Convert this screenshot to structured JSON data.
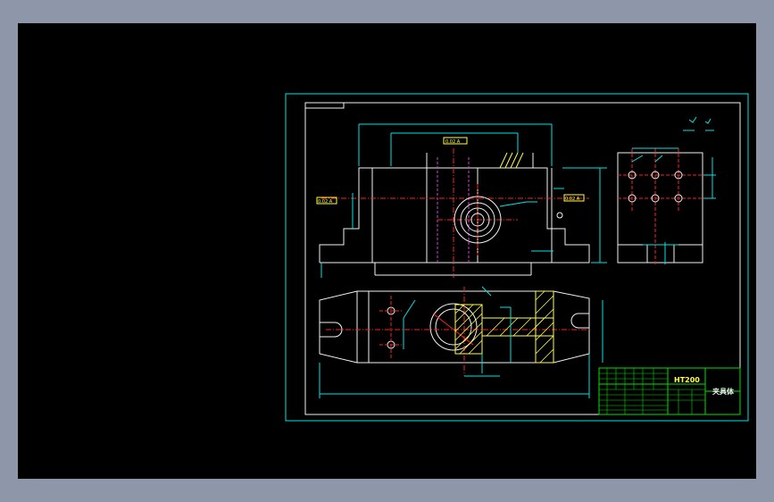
{
  "colors": {
    "background": "#8e97a9",
    "viewport": "#000000",
    "frame": "#00e5e5",
    "outline": "#f2f2f2",
    "table": "#00e000",
    "center": "#ff2020",
    "hatch": "#ffff40"
  },
  "title_block": {
    "material": "HT200",
    "part_name": "夹具体"
  },
  "tolerance_boxes": {
    "left": "0.02 A",
    "right": "0.02 A",
    "top": "0.02 A"
  }
}
